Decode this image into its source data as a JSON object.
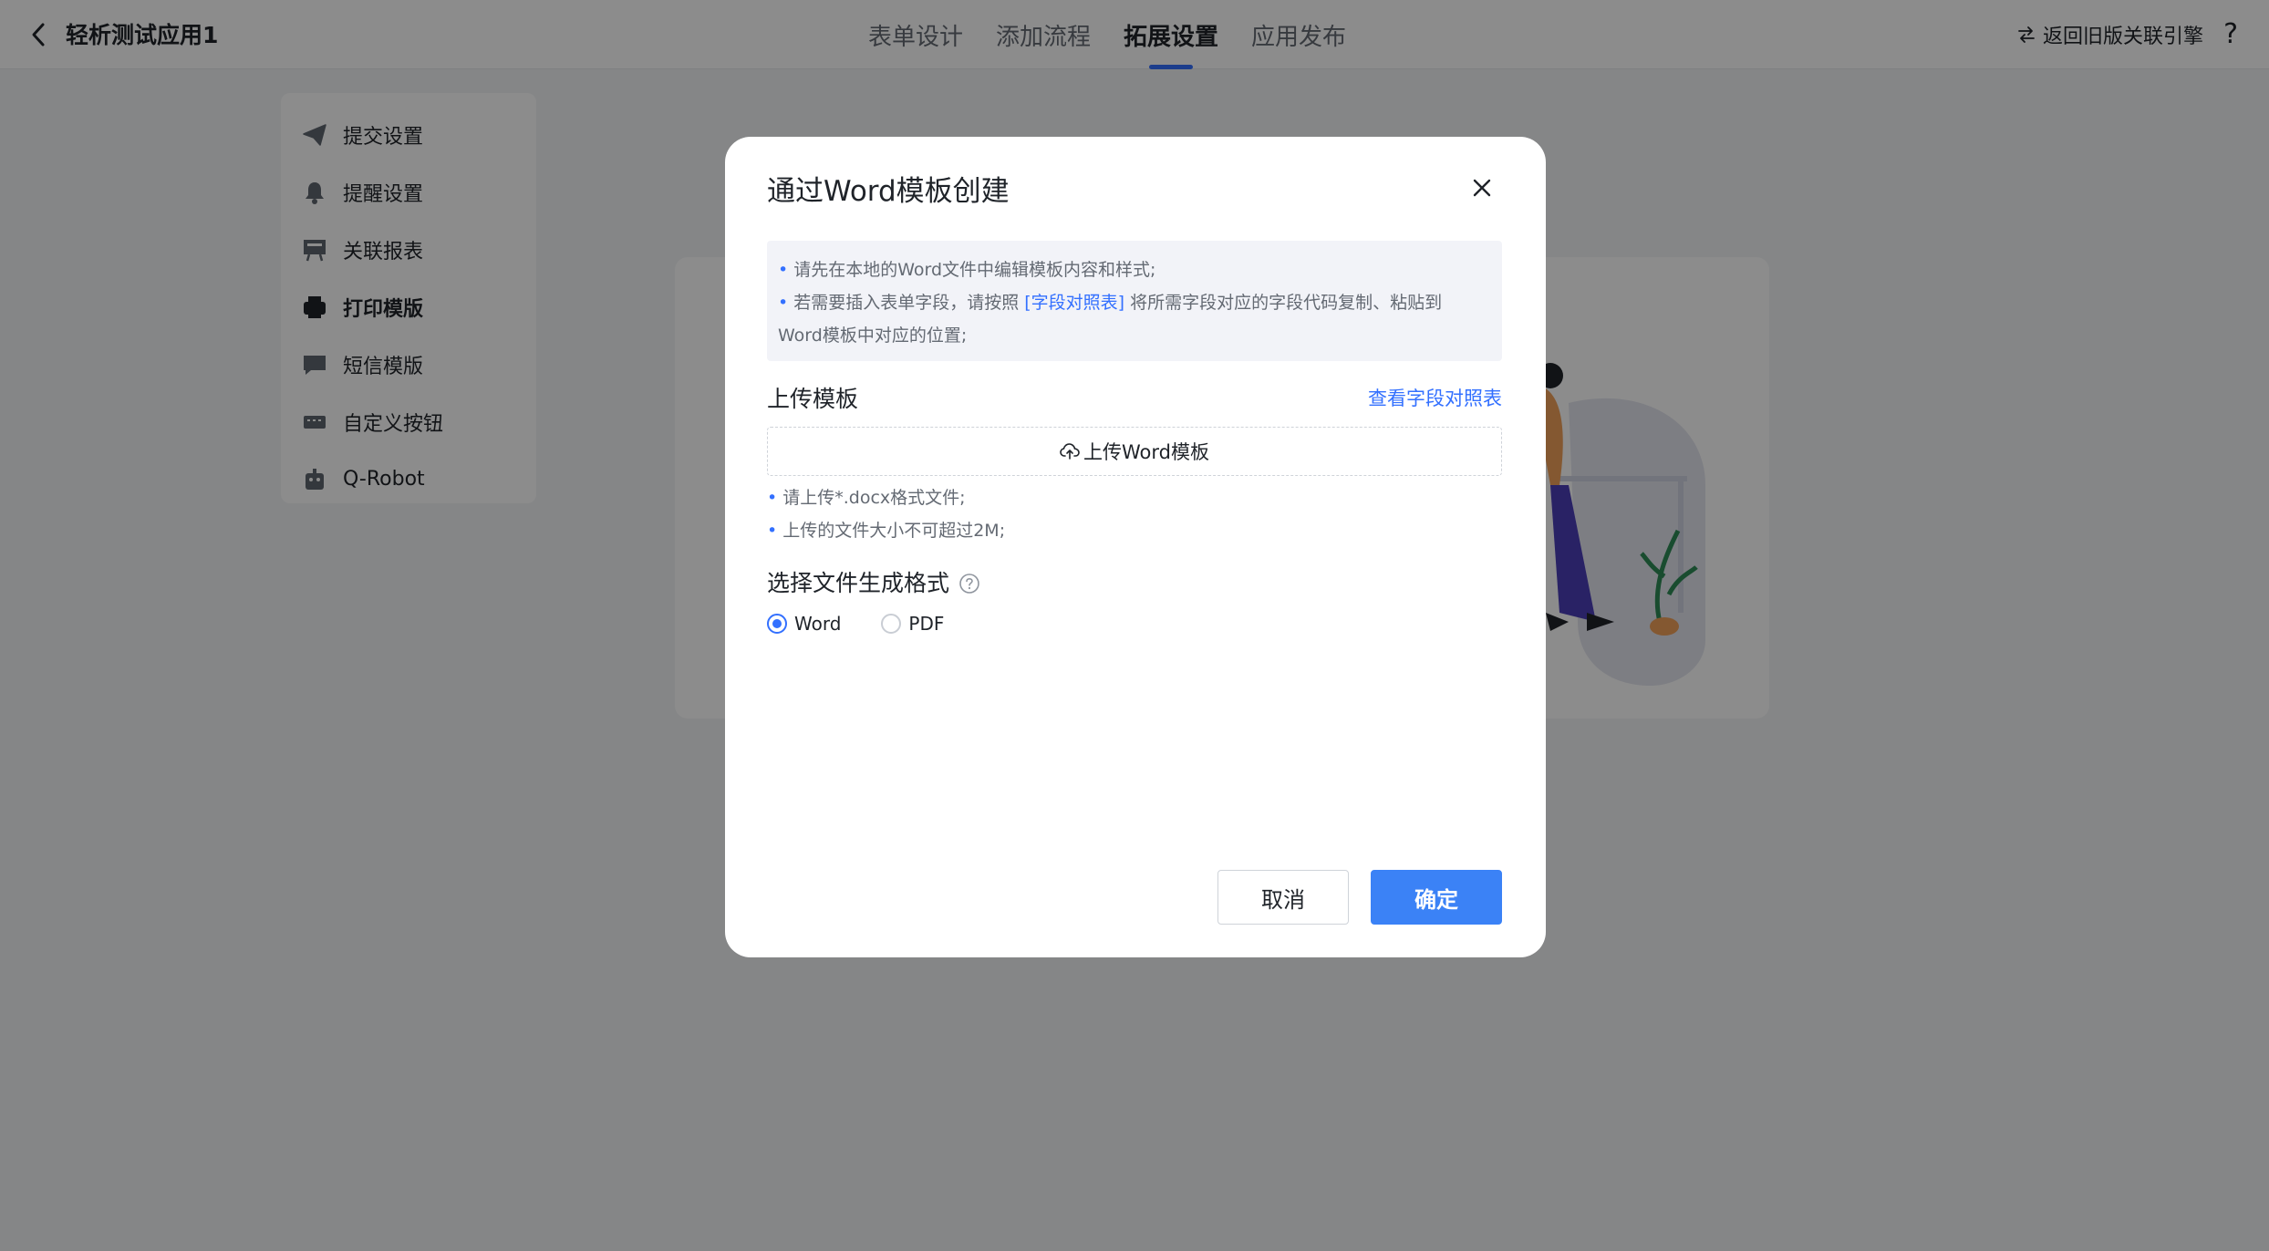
{
  "header": {
    "app_title": "轻析测试应用1",
    "tabs": [
      {
        "label": "表单设计"
      },
      {
        "label": "添加流程"
      },
      {
        "label": "拓展设置"
      },
      {
        "label": "应用发布"
      }
    ],
    "active_tab": "拓展设置",
    "legacy_link": "返回旧版关联引擎",
    "help": "?"
  },
  "sidebar": {
    "items": [
      {
        "label": "提交设置",
        "icon": "paper-plane-icon"
      },
      {
        "label": "提醒设置",
        "icon": "bell-icon"
      },
      {
        "label": "关联报表",
        "icon": "report-icon"
      },
      {
        "label": "打印模版",
        "icon": "printer-icon"
      },
      {
        "label": "短信模版",
        "icon": "message-icon"
      },
      {
        "label": "自定义按钮",
        "icon": "keyboard-icon"
      },
      {
        "label": "Q-Robot",
        "icon": "robot-icon"
      }
    ],
    "active_item": "打印模版"
  },
  "modal": {
    "title": "通过Word模板创建",
    "notice": {
      "line1": "请先在本地的Word文件中编辑模板内容和样式;",
      "line2_prefix": "若需要插入表单字段，请按照 ",
      "line2_link": "[字段对照表]",
      "line2_suffix": " 将所需字段对应的字段代码复制、粘贴到",
      "line3": "Word模板中对应的位置;"
    },
    "upload_section_label": "上传模板",
    "field_table_link": "查看字段对照表",
    "upload_button": "上传Word模板",
    "hints": [
      "请上传*.docx格式文件;",
      "上传的文件大小不可超过2M;"
    ],
    "format_label": "选择文件生成格式",
    "format_options": [
      {
        "label": "Word",
        "checked": true
      },
      {
        "label": "PDF",
        "checked": false
      }
    ],
    "cancel_label": "取消",
    "ok_label": "确定"
  },
  "colors": {
    "accent": "#3370ff",
    "primary_button": "#3b82f6",
    "overlay": "rgba(0,0,0,0.45)"
  }
}
